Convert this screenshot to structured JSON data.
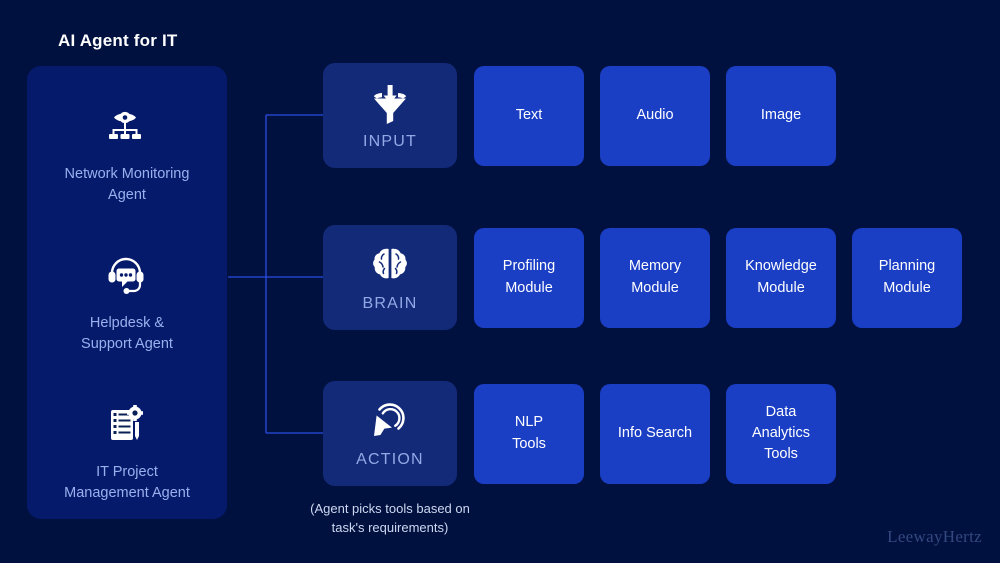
{
  "page": {
    "title": "AI Agent for IT",
    "background_color": "#001140",
    "watermark": "LeewayHertz"
  },
  "sidebar": {
    "panel_color": "#061a6b",
    "label_color": "#9ab0ee",
    "items": [
      {
        "icon": "network-monitor-eye-icon",
        "label": "Network Monitoring\nAgent"
      },
      {
        "icon": "headset-chat-support-icon",
        "label": "Helpdesk &\nSupport Agent"
      },
      {
        "icon": "checklist-gear-pen-icon",
        "label": "IT Project\nManagement Agent"
      }
    ]
  },
  "rows": [
    {
      "id": "input",
      "lead": {
        "icon": "funnel-download-icon",
        "label": "INPUT",
        "color": "#132a79",
        "label_color": "#93a9e6"
      },
      "modules": [
        {
          "label": "Text",
          "color": "#1a3ec4"
        },
        {
          "label": "Audio",
          "color": "#1a3ec4"
        },
        {
          "label": "Image",
          "color": "#1a3ec4"
        }
      ]
    },
    {
      "id": "brain",
      "lead": {
        "icon": "brain-icon",
        "label": "BRAIN",
        "color": "#132a79",
        "label_color": "#93a9e6"
      },
      "modules": [
        {
          "label": "Profiling\nModule",
          "color": "#1a3ec4"
        },
        {
          "label": "Memory\nModule",
          "color": "#1a3ec4"
        },
        {
          "label": "Knowledge\nModule",
          "color": "#1a3ec4"
        },
        {
          "label": "Planning\nModule",
          "color": "#1a3ec4"
        }
      ]
    },
    {
      "id": "action",
      "lead": {
        "icon": "cursor-click-icon",
        "label": "ACTION",
        "color": "#132a79",
        "label_color": "#93a9e6"
      },
      "modules": [
        {
          "label": "NLP\nTools",
          "color": "#1a3ec4"
        },
        {
          "label": "Info Search",
          "color": "#1a3ec4"
        },
        {
          "label": "Data\nAnalytics\nTools",
          "color": "#1a3ec4"
        }
      ]
    }
  ],
  "caption": "(Agent picks tools based on\ntask's requirements)",
  "connector": {
    "color": "#2b4de0"
  }
}
